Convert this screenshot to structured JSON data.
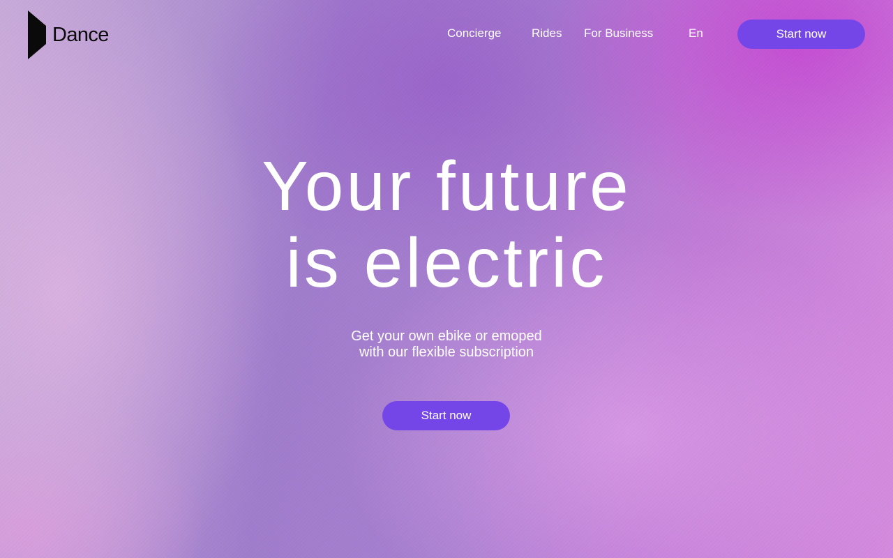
{
  "brand": {
    "name": "Dance",
    "logo_icon": "dance-logo-mark"
  },
  "nav": {
    "items": [
      {
        "label": "Concierge"
      },
      {
        "label": "Rides"
      },
      {
        "label": "For Business"
      }
    ],
    "language": "En",
    "cta_label": "Start now"
  },
  "hero": {
    "title_line1": "Your future",
    "title_line2": "is electric",
    "subtitle_line1": "Get your own ebike or emoped",
    "subtitle_line2": "with our flexible subscription",
    "cta_label": "Start now"
  },
  "colors": {
    "accent": "#7446e8",
    "text": "#ffffff",
    "logo": "#0a0a0a"
  }
}
